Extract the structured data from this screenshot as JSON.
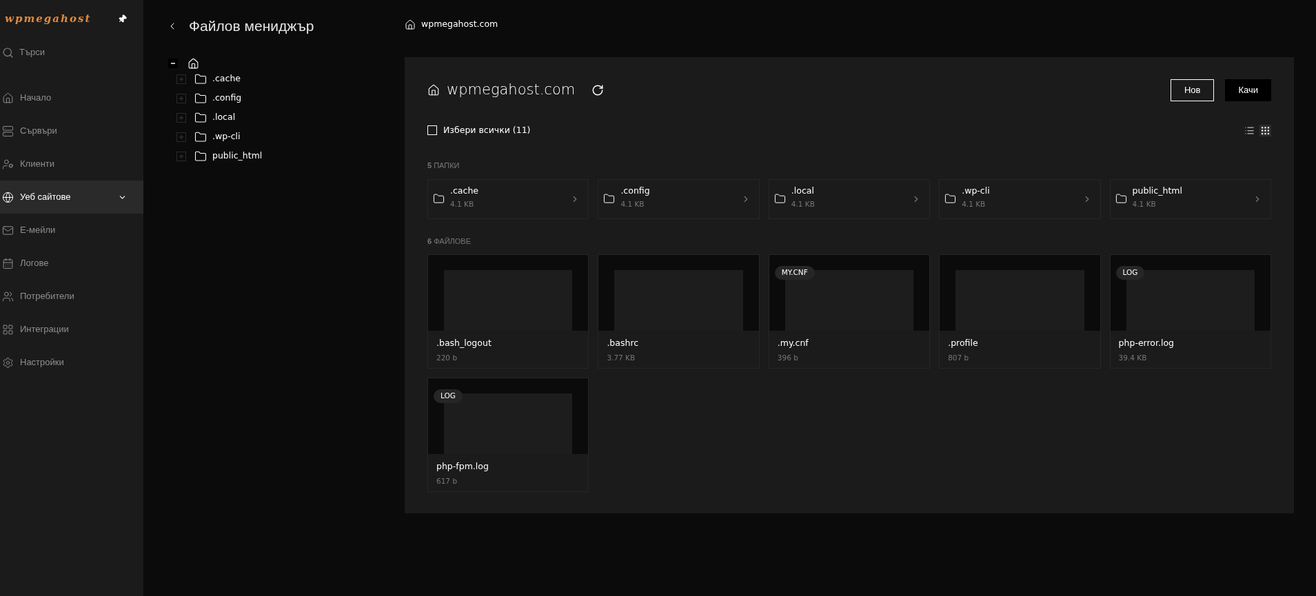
{
  "sidebar": {
    "logo": "wpmegahost",
    "search": {
      "placeholder": "Търси"
    },
    "items": [
      {
        "label": "Начало",
        "selected": false,
        "expandable": false
      },
      {
        "label": "Сървъри",
        "selected": false,
        "expandable": false
      },
      {
        "label": "Клиенти",
        "selected": false,
        "expandable": false
      },
      {
        "label": "Уеб сайтове",
        "selected": true,
        "expandable": true
      },
      {
        "label": "Е-мейли",
        "selected": false,
        "expandable": false
      },
      {
        "label": "Логове",
        "selected": false,
        "expandable": false
      },
      {
        "label": "Потребители",
        "selected": false,
        "expandable": false
      },
      {
        "label": "Интеграции",
        "selected": false,
        "expandable": false
      },
      {
        "label": "Настройки",
        "selected": false,
        "expandable": false
      }
    ]
  },
  "tree_panel": {
    "title": "Файлов мениджър",
    "tree": {
      "expanded": true,
      "children": [
        {
          "label": ".cache",
          "expanded": false
        },
        {
          "label": ".config",
          "expanded": false
        },
        {
          "label": ".local",
          "expanded": false
        },
        {
          "label": ".wp-cli",
          "expanded": false
        },
        {
          "label": "public_html",
          "expanded": false
        }
      ]
    }
  },
  "breadcrumb": "wpmegahost.com",
  "main": {
    "title": "wpmegahost.com",
    "buttons": [
      {
        "label": "Нов",
        "kind": "outline"
      },
      {
        "label": "Качи",
        "kind": "solid"
      }
    ],
    "select_all": {
      "label": "Избери всички (11)",
      "checked": false
    },
    "views": [
      {
        "selected": false
      },
      {
        "selected": true
      }
    ],
    "folders_heading": {
      "count": "5",
      "label": "ПАПКИ"
    },
    "folders": [
      {
        "name": ".cache",
        "size": "4.1 KB"
      },
      {
        "name": ".config",
        "size": "4.1 KB"
      },
      {
        "name": ".local",
        "size": "4.1 KB"
      },
      {
        "name": ".wp-cli",
        "size": "4.1 KB"
      },
      {
        "name": "public_html",
        "size": "4.1 KB"
      }
    ],
    "files_heading": {
      "count": "6",
      "label": "ФАЙЛОВЕ"
    },
    "files": [
      {
        "name": ".bash_logout",
        "size": "220 b"
      },
      {
        "name": ".bashrc",
        "size": "3.77 KB"
      },
      {
        "name": ".my.cnf",
        "size": "396 b",
        "badge": "MY.CNF"
      },
      {
        "name": ".profile",
        "size": "807 b"
      },
      {
        "name": "php-error.log",
        "size": "39.4 KB",
        "badge": "LOG"
      },
      {
        "name": "php-fpm.log",
        "size": "617 b",
        "badge": "LOG"
      }
    ]
  }
}
